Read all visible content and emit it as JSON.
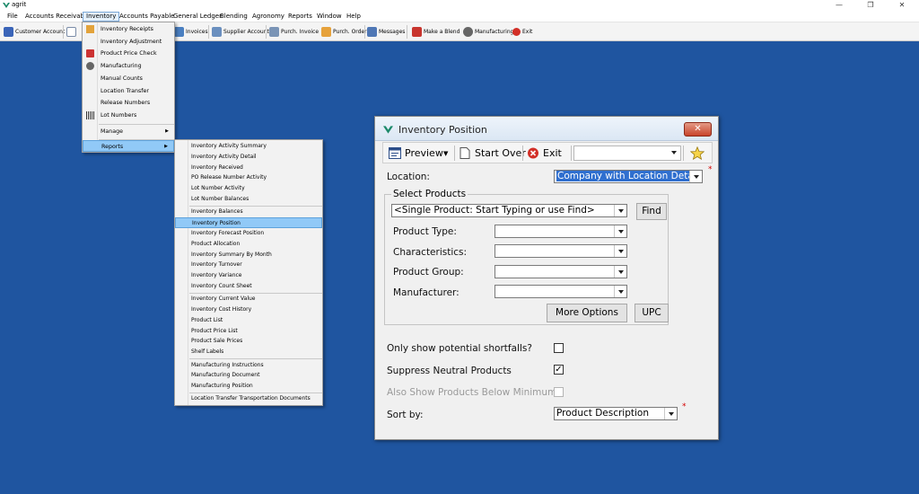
{
  "window": {
    "title": "agrit",
    "minimize": "—",
    "restore": "❐",
    "close": "✕"
  },
  "menubar": [
    "File",
    "Accounts Receivable",
    "Inventory",
    "Accounts Payable",
    "General Ledger",
    "Blending",
    "Agronomy",
    "Reports",
    "Window",
    "Help"
  ],
  "toolbar": [
    {
      "label": "Customer Account",
      "icon": "customer-account-icon",
      "color": "#3a64b8"
    },
    {
      "label": "Invoices",
      "icon": "invoices-icon",
      "color": "#4a7fc1"
    },
    {
      "label": "Supplier Account",
      "icon": "supplier-account-icon",
      "color": "#6a8fbf"
    },
    {
      "label": "Purch. Invoice",
      "icon": "purchase-invoice-icon",
      "color": "#7a94b6"
    },
    {
      "label": "Purch. Order",
      "icon": "purchase-order-icon",
      "color": "#e6a23c"
    },
    {
      "label": "Messages",
      "icon": "messages-icon",
      "color": "#4f77b5"
    },
    {
      "label": "Make a Blend",
      "icon": "make-a-blend-icon",
      "color": "#c8352e"
    },
    {
      "label": "Manufacturing",
      "icon": "manufacturing-icon",
      "color": "#666666"
    },
    {
      "label": "Exit",
      "icon": "exit-icon",
      "color": "#d22f27"
    }
  ],
  "inventory_menu": {
    "items": [
      "Inventory Receipts",
      "Inventory Adjustment",
      "Product Price Check",
      "Manufacturing",
      "Manual Counts",
      "Location Transfer",
      "Release Numbers",
      "Lot Numbers"
    ],
    "manage": "Manage",
    "reports": "Reports",
    "arrow": "▶"
  },
  "reports_submenu": {
    "group1": [
      "Inventory Activity Summary",
      "Inventory Activity Detail",
      "Inventory Received",
      "PO Release Number Activity",
      "Lot Number Activity",
      "Lot Number Balances"
    ],
    "group2": [
      "Inventory Balances",
      "Inventory Position",
      "Inventory Forecast Position",
      "Product Allocation",
      "Inventory Summary By Month",
      "Inventory Turnover",
      "Inventory Variance",
      "Inventory Count Sheet"
    ],
    "group3": [
      "Inventory Current Value",
      "Inventory Cost History",
      "Product List",
      "Product Price List",
      "Product Sale Prices",
      "Shelf Labels"
    ],
    "group4": [
      "Manufacturing Instructions",
      "Manufacturing Document",
      "Manufacturing Position"
    ],
    "group5": [
      "Location Transfer Transportation Documents"
    ],
    "highlighted": "Inventory Position"
  },
  "dialog": {
    "title": "Inventory Position",
    "close": "✕",
    "toolbar": {
      "preview": "Preview",
      "preview_arrow": "▼",
      "start_over": "Start Over",
      "exit": "Exit"
    },
    "location_label": "Location:",
    "location_value": "Company with Location Details",
    "required_marker": "*",
    "select_products": "Select Products",
    "product_value": "<Single Product: Start Typing or use Find>",
    "find": "Find",
    "product_type": "Product Type:",
    "characteristics": "Characteristics:",
    "product_group": "Product Group:",
    "manufacturer": "Manufacturer:",
    "more_options": "More Options",
    "upc": "UPC",
    "only_shortfalls": "Only show potential shortfalls?",
    "suppress_neutral": "Suppress Neutral Products",
    "also_below_min": "Also Show Products Below Minimum?",
    "check_mark": "✓",
    "sort_by_label": "Sort by:",
    "sort_by_value": "Product Description"
  }
}
